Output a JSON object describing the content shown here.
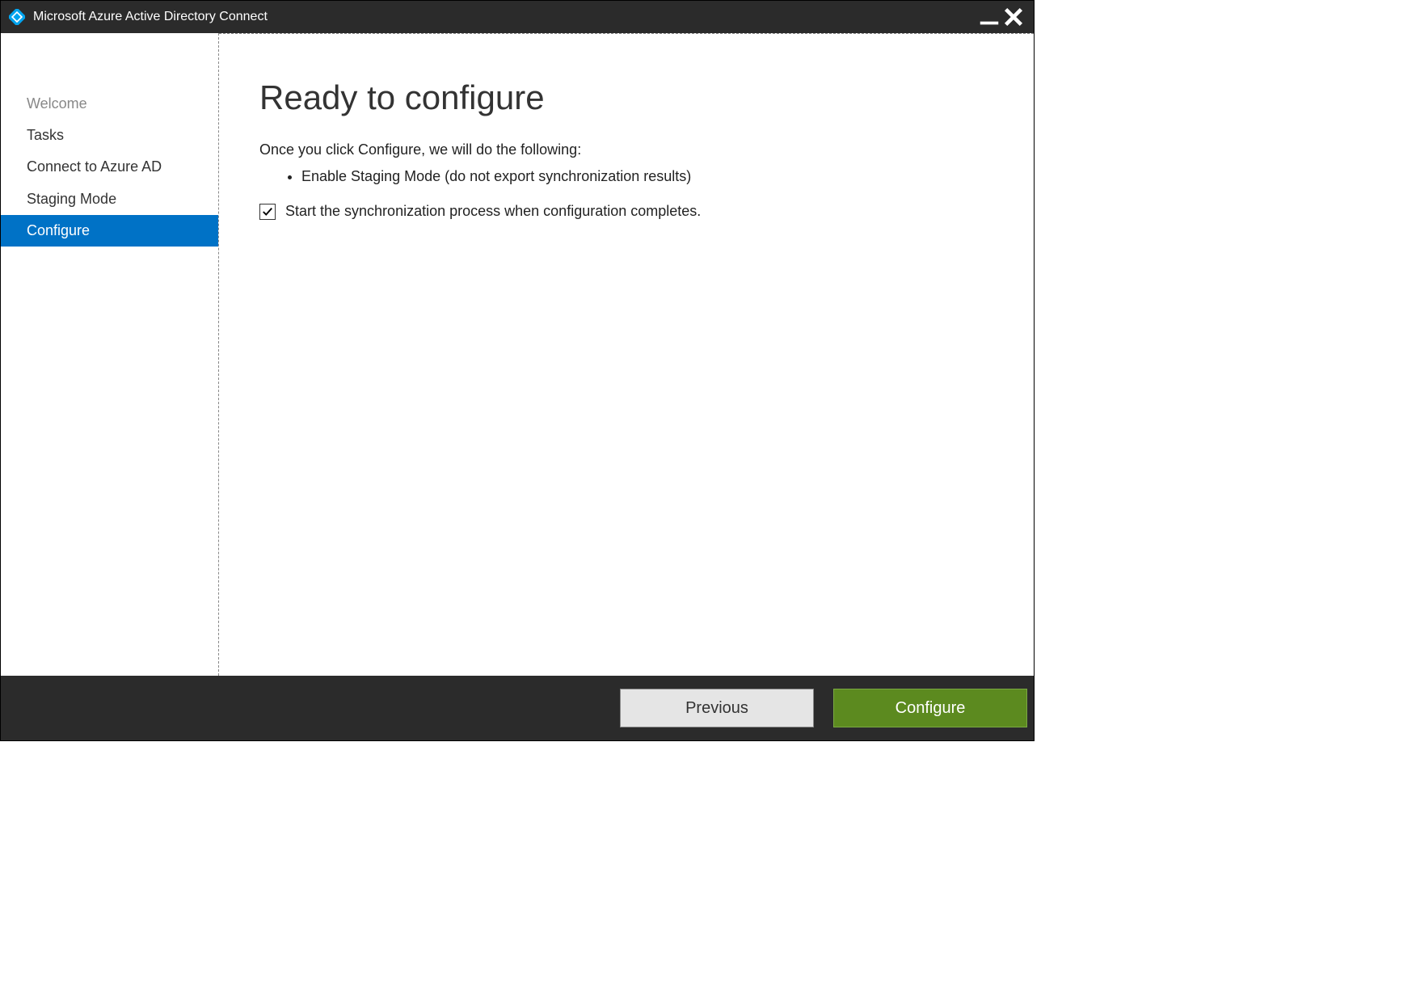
{
  "titlebar": {
    "title": "Microsoft Azure Active Directory Connect"
  },
  "sidebar": {
    "items": [
      {
        "label": "Welcome",
        "state": "disabled"
      },
      {
        "label": "Tasks",
        "state": "normal"
      },
      {
        "label": "Connect to Azure AD",
        "state": "normal"
      },
      {
        "label": "Staging Mode",
        "state": "normal"
      },
      {
        "label": "Configure",
        "state": "active"
      }
    ]
  },
  "main": {
    "heading": "Ready to configure",
    "intro": "Once you click Configure, we will do the following:",
    "actions": [
      "Enable Staging Mode (do not export synchronization results)"
    ],
    "checkbox": {
      "checked": true,
      "label": "Start the synchronization process when configuration completes."
    }
  },
  "footer": {
    "previous_label": "Previous",
    "configure_label": "Configure"
  }
}
